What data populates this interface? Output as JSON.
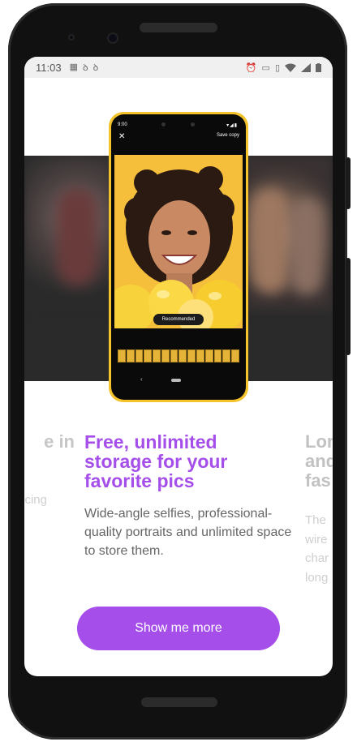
{
  "status_bar": {
    "time": "11:03",
    "left_icons": [
      "sim-icon",
      "data-saver-icon",
      "data-saver-icon"
    ],
    "right_icons": [
      "alarm-icon",
      "cast-icon",
      "vibrate-icon",
      "wifi-icon",
      "signal-icon",
      "battery-icon"
    ]
  },
  "mockup": {
    "time": "9:00",
    "save_label": "Save copy",
    "recommended_label": "Recommended"
  },
  "cards": {
    "left_title_partial": "e in",
    "left_sub_partial": "cing",
    "main_title": "Free, unlimited storage for your favorite pics",
    "main_description": "Wide-angle selfies, professional-quality portraits and unlimited space to store them.",
    "right_title_partial_1": "Lon",
    "right_title_partial_2": "and",
    "right_title_partial_3": "fas",
    "right_desc_partial_1": "The",
    "right_desc_partial_2": "wire",
    "right_desc_partial_3": "char",
    "right_desc_partial_4": "long"
  },
  "cta": {
    "label": "Show me more"
  },
  "colors": {
    "accent": "#a54ee9",
    "mockup_frame": "#f4c22a"
  }
}
